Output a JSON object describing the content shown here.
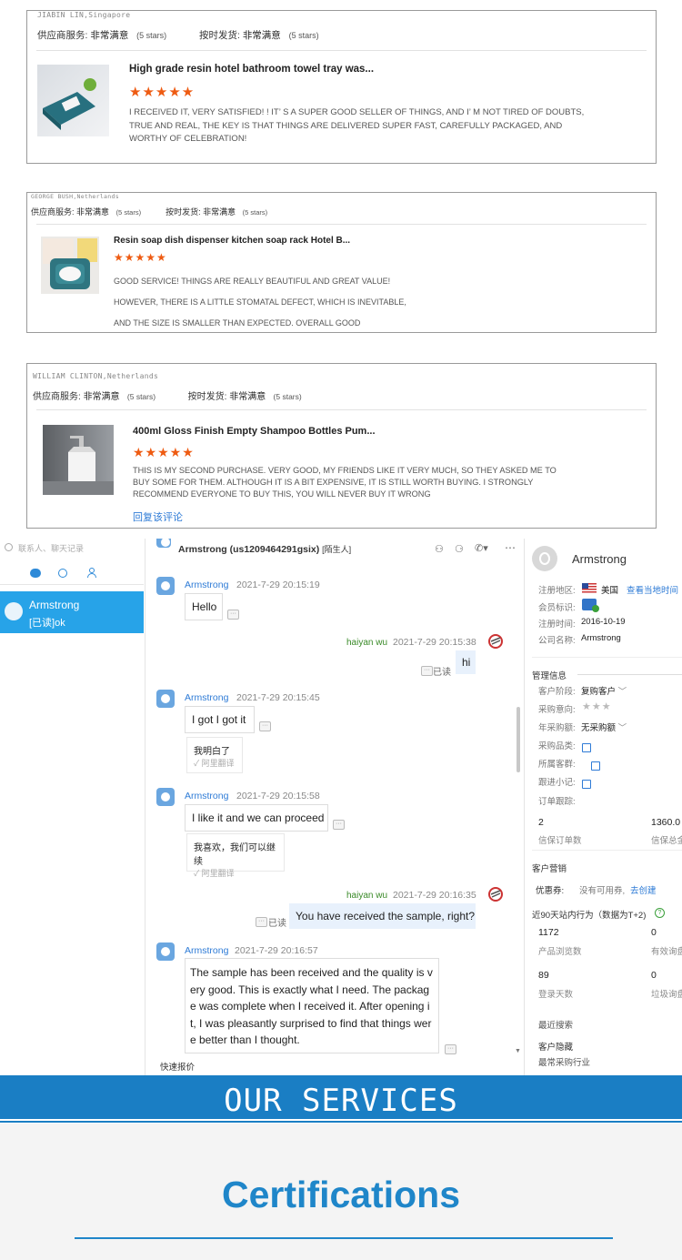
{
  "reviews": [
    {
      "buyer": "JIABIN LIN,Singapore",
      "service_label": "供应商服务:",
      "service_value": "非常满意",
      "service_stars": "(5 stars)",
      "ship_label": "按时发货:",
      "ship_value": "非常满意",
      "ship_stars": "(5 stars)",
      "product": "High grade resin hotel bathroom towel tray was...",
      "rating": 5,
      "text": "I RECEIVED IT, VERY SATISFIED! ! IT’ S A SUPER GOOD SELLER OF THINGS, AND I’ M NOT TIRED OF DOUBTS, TRUE AND REAL, THE KEY IS THAT THINGS ARE DELIVERED SUPER FAST, CAREFULLY PACKAGED, AND WORTHY OF CELEBRATION!"
    },
    {
      "buyer": "GEORGE BUSH,Netherlands",
      "service_label": "供应商服务:",
      "service_value": "非常满意",
      "service_stars": "(5 stars)",
      "ship_label": "按时发货:",
      "ship_value": "非常满意",
      "ship_stars": "(5 stars)",
      "product": "Resin soap dish dispenser kitchen soap rack Hotel B...",
      "rating": 5,
      "text_lines": [
        "GOOD SERVICE! THINGS ARE REALLY BEAUTIFUL AND GREAT VALUE!",
        "HOWEVER, THERE IS A LITTLE STOMATAL DEFECT, WHICH IS INEVITABLE,",
        "AND THE SIZE IS SMALLER THAN EXPECTED. OVERALL GOOD"
      ]
    },
    {
      "buyer": "WILLIAM CLINTON,Netherlands",
      "service_label": "供应商服务:",
      "service_value": "非常满意",
      "service_stars": "(5 stars)",
      "ship_label": "按时发货:",
      "ship_value": "非常满意",
      "ship_stars": "(5 stars)",
      "product": "400ml Gloss Finish Empty Shampoo Bottles Pum...",
      "rating": 5,
      "text": "THIS IS MY SECOND PURCHASE. VERY GOOD, MY FRIENDS LIKE IT VERY MUCH, SO THEY ASKED ME TO BUY SOME FOR THEM. ALTHOUGH IT IS A BIT EXPENSIVE, IT IS STILL WORTH BUYING. I STRONGLY RECOMMEND EVERYONE TO BUY THIS, YOU WILL NEVER BUY IT WRONG",
      "reply": "回复该评论"
    }
  ],
  "chat": {
    "search_placeholder": "联系人、聊天记录",
    "contact": {
      "name": "Armstrong",
      "status": "[已读]ok"
    },
    "header": {
      "name": "Armstrong",
      "id": "(us1209464291gsix)",
      "tag": "[陌生人]"
    },
    "messages": [
      {
        "from": "Armstrong",
        "time": "2021-7-29 20:15:19",
        "text": "Hello"
      },
      {
        "from": "haiyan wu",
        "time": "2021-7-29 20:15:38",
        "text": "hi",
        "read": "已读"
      },
      {
        "from": "Armstrong",
        "time": "2021-7-29 20:15:45",
        "text": "I got I got it",
        "translation": "我明白了",
        "translator": "阿里翻译"
      },
      {
        "from": "Armstrong",
        "time": "2021-7-29 20:15:58",
        "text": "I like it and we can proceed",
        "translation": "我喜欢，我们可以继续",
        "translator": "阿里翻译"
      },
      {
        "from": "haiyan wu",
        "time": "2021-7-29 20:16:35",
        "text": "You have received the sample, right?",
        "read": "已读"
      },
      {
        "from": "Armstrong",
        "time": "2021-7-29 20:16:57",
        "text": "The sample has been received and the quality is very good. This is exactly what I need. The package was complete when I received it. After opening it, I was pleasantly surprised to find that things were better than I thought."
      }
    ],
    "quick_reply": "快速报价",
    "profile": {
      "name": "Armstrong",
      "region_label": "注册地区:",
      "region_value": "美国",
      "region_link": "查看当地时间",
      "member_label": "会员标识:",
      "regtime_label": "注册时间:",
      "regtime_value": "2016-10-19",
      "company_label": "公司名称:",
      "company_value": "Armstrong",
      "mgmt_title": "管理信息",
      "stage_label": "客户阶段:",
      "stage_value": "复购客户",
      "intent_label": "采购意向:",
      "annual_label": "年采购额:",
      "annual_value": "无采购额",
      "category_label": "采购品类:",
      "owner_label": "所属客群:",
      "note_label": "跟进小记:",
      "order_label": "订单跟踪:",
      "orders_num": "2",
      "orders_sub": "信保订单数",
      "amount_num": "1360.0",
      "amount_sub": "信保总金",
      "marketing_title": "客户营销",
      "coupon_label": "优惠券:",
      "coupon_value": "没有可用券,",
      "coupon_link": "去创建",
      "behavior_title": "近90天站内行为（数据为T+2)",
      "views_num": "1172",
      "views_sub": "产品浏览数",
      "inquiries_num": "0",
      "inquiries_sub": "有效询盘",
      "login_num": "89",
      "login_sub": "登录天数",
      "spam_num": "0",
      "spam_sub": "垃圾询盘",
      "recent_search": "最近搜索",
      "hidden": "客户隐藏",
      "industry": "最常采购行业"
    }
  },
  "banner": {
    "title": "OUR SERVICES"
  },
  "certifications": {
    "title": "Certifications"
  },
  "colors": {
    "accent": "#1a7ec4",
    "star": "#ee5b12",
    "link": "#2e7bd6",
    "my_name": "#3a8a28"
  }
}
